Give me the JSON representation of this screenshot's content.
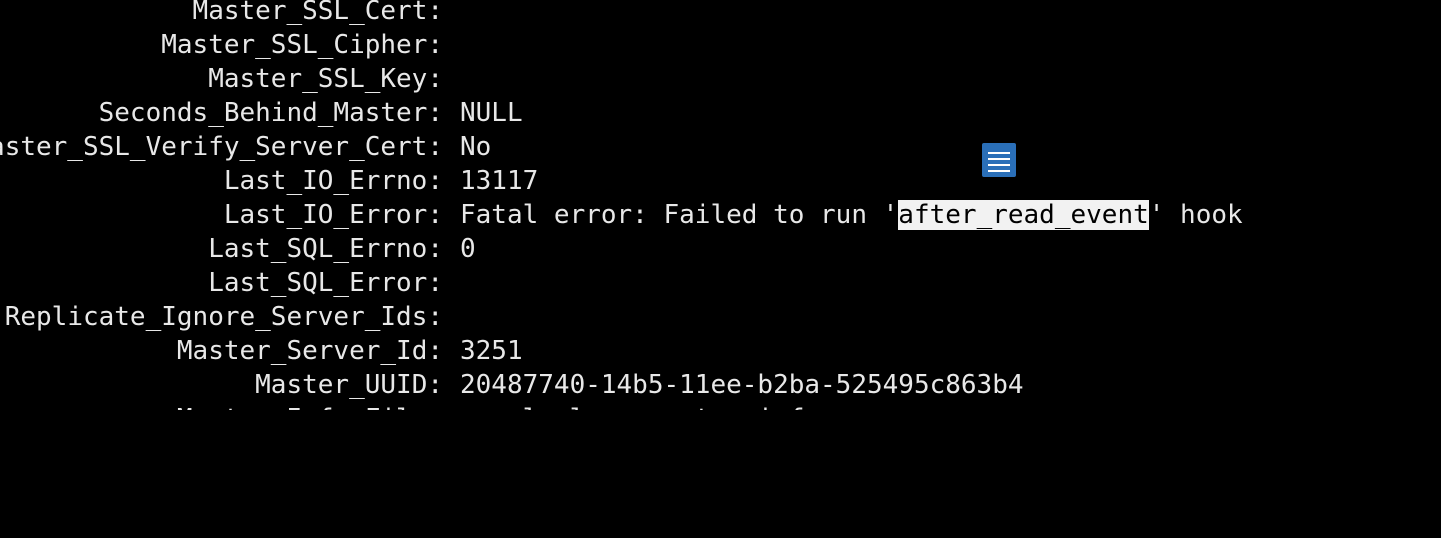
{
  "colors": {
    "background": "#000000",
    "text": "#e8e8e8",
    "selection_bg": "#f2f2f2",
    "selection_fg": "#000000",
    "icon_blue": "#2a6fb8"
  },
  "rows": [
    {
      "key": "Master_SSL_Cert:",
      "value": ""
    },
    {
      "key": "Master_SSL_Cipher:",
      "value": ""
    },
    {
      "key": "Master_SSL_Key:",
      "value": ""
    },
    {
      "key": "Seconds_Behind_Master:",
      "value": "NULL"
    },
    {
      "key": "Master_SSL_Verify_Server_Cert:",
      "value": "No"
    },
    {
      "key": "Last_IO_Errno:",
      "value": "13117"
    },
    {
      "key": "Last_IO_Error:",
      "value_prefix": "Fatal error: Failed to run '",
      "value_selected": "after_read_event",
      "value_suffix": "' hook"
    },
    {
      "key": "Last_SQL_Errno:",
      "value": "0"
    },
    {
      "key": "Last_SQL_Error:",
      "value": ""
    },
    {
      "key": "Replicate_Ignore_Server_Ids:",
      "value": ""
    },
    {
      "key": "Master_Server_Id:",
      "value": "3251"
    },
    {
      "key": "Master_UUID:",
      "value": "20487740-14b5-11ee-b2ba-525495c863b4"
    },
    {
      "key": "Master_Info_File:",
      "value": "mysql.slave_master_info"
    }
  ],
  "overlay_icon": "document-lines-icon"
}
